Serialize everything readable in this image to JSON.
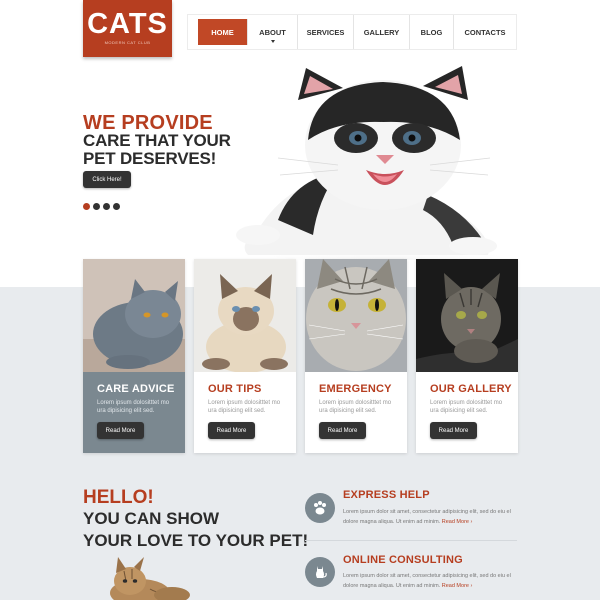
{
  "logo": {
    "title": "CATS",
    "subtitle": "MODERN CAT CLUB"
  },
  "nav": {
    "items": [
      {
        "label": "Home",
        "active": true
      },
      {
        "label": "About",
        "has_caret": true
      },
      {
        "label": "Services"
      },
      {
        "label": "Gallery"
      },
      {
        "label": "Blog"
      },
      {
        "label": "Contacts"
      }
    ]
  },
  "hero": {
    "heading": "WE PROVIDE",
    "subheading": "CARE THAT YOUR PET DESERVES!",
    "button_label": "Click Here!",
    "slide_count": 4,
    "active_slide": 1
  },
  "cards": [
    {
      "title": "CARE ADVICE",
      "text": "Lorem ipsum dolositttet mo ura dipisicing elit sed.",
      "button": "Read More"
    },
    {
      "title": "OUR TIPS",
      "text": "Lorem ipsum dolositttet mo ura dipisicing elit sed.",
      "button": "Read More"
    },
    {
      "title": "EMERGENCY",
      "text": "Lorem ipsum dolositttet mo ura dipisicing elit sed.",
      "button": "Read More"
    },
    {
      "title": "OUR GALLERY",
      "text": "Lorem ipsum dolositttet mo ura dipisicing elit sed.",
      "button": "Read More"
    }
  ],
  "hello": {
    "heading": "HELLO!",
    "line1": "YOU CAN SHOW",
    "line2": "YOUR LOVE TO YOUR PET!"
  },
  "services": [
    {
      "title": "EXPRESS HELP",
      "text": "Lorem ipsum dolor sit amet, consectetur adipisicing elit, sed do eiu el dolore magna aliqua. Ut enim ad minim.",
      "more": "Read More",
      "icon": "paw-icon"
    },
    {
      "title": "ONLINE CONSULTING",
      "text": "Lorem ipsum dolor sit amet, consectetur adipisicing elit, sed do eiu el dolore magna aliqua. Ut enim ad minim.",
      "more": "Read More",
      "icon": "cat-icon"
    }
  ],
  "colors": {
    "accent": "#b63e20",
    "dark": "#333333",
    "slate": "#7b8890",
    "band": "#e8ebee"
  }
}
